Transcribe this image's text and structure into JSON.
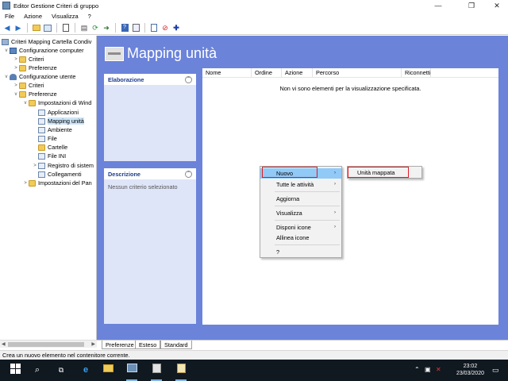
{
  "window": {
    "title": "Editor Gestione Criteri di gruppo",
    "controls": {
      "minimize": "—",
      "maximize": "❐",
      "close": "✕"
    }
  },
  "menubar": {
    "items": [
      "File",
      "Azione",
      "Visualizza",
      "?"
    ]
  },
  "toolbar": {
    "icons": [
      "back-icon",
      "forward-icon",
      "up-folder-icon",
      "show-tree-icon",
      "properties-icon",
      "print-icon",
      "refresh-icon",
      "export-icon",
      "help-icon",
      "filter-icon",
      "stop-icon",
      "add-icon"
    ]
  },
  "tree": {
    "items": [
      {
        "label": "Criteri Mapping Cartella Condiv",
        "icon": "policy-icon",
        "expander": ""
      },
      {
        "label": "Configurazione computer",
        "icon": "computer-icon",
        "expander": "v"
      },
      {
        "label": "Criteri",
        "icon": "folder-icon",
        "expander": ">"
      },
      {
        "label": "Preferenze",
        "icon": "folder-icon",
        "expander": ">"
      },
      {
        "label": "Configurazione utente",
        "icon": "user-icon",
        "expander": "v"
      },
      {
        "label": "Criteri",
        "icon": "folder-icon",
        "expander": ">"
      },
      {
        "label": "Preferenze",
        "icon": "folder-icon",
        "expander": "v"
      },
      {
        "label": "Impostazioni di Wind",
        "icon": "folder-icon",
        "expander": "v"
      },
      {
        "label": "Applicazioni",
        "icon": "applications-icon",
        "expander": ""
      },
      {
        "label": "Mapping unità",
        "icon": "drive-map-icon",
        "expander": ""
      },
      {
        "label": "Ambiente",
        "icon": "environment-icon",
        "expander": ""
      },
      {
        "label": "File",
        "icon": "file-icon",
        "expander": ""
      },
      {
        "label": "Cartelle",
        "icon": "folder-icon",
        "expander": ""
      },
      {
        "label": "File INI",
        "icon": "ini-file-icon",
        "expander": ""
      },
      {
        "label": "Registro di sistem",
        "icon": "registry-icon",
        "expander": ">"
      },
      {
        "label": "Collegamenti",
        "icon": "shortcut-icon",
        "expander": ""
      },
      {
        "label": "Impostazioni del Pan",
        "icon": "control-panel-icon",
        "expander": ">"
      }
    ]
  },
  "main": {
    "title": "Mapping unità",
    "panels": {
      "processing": {
        "title": "Elaborazione",
        "collapse": "⌃"
      },
      "description": {
        "title": "Descrizione",
        "collapse": "⌃",
        "text": "Nessun criterio selezionato"
      }
    },
    "columns": [
      "Nome",
      "Ordine",
      "Azione",
      "Percorso",
      "Riconnetti"
    ],
    "empty_message": "Non vi sono elementi per la visualizzazione specificata."
  },
  "tabs": [
    "Preferenze",
    "Esteso",
    "Standard"
  ],
  "status": "Crea un nuovo elemento nel contenitore corrente.",
  "context_menu": {
    "items": [
      "Nuovo",
      "Tutte le attività",
      "Aggiorna",
      "Visualizza",
      "Disponi icone",
      "Allinea icone",
      "?"
    ],
    "arrow": "›",
    "submenu": [
      "Unità mappata"
    ]
  },
  "taskbar": {
    "time": "23:02",
    "date": "23/03/2020"
  },
  "colors": {
    "main_bg": "#6b83d9",
    "highlight": "#91c9f7",
    "callout": "#e0191f"
  }
}
